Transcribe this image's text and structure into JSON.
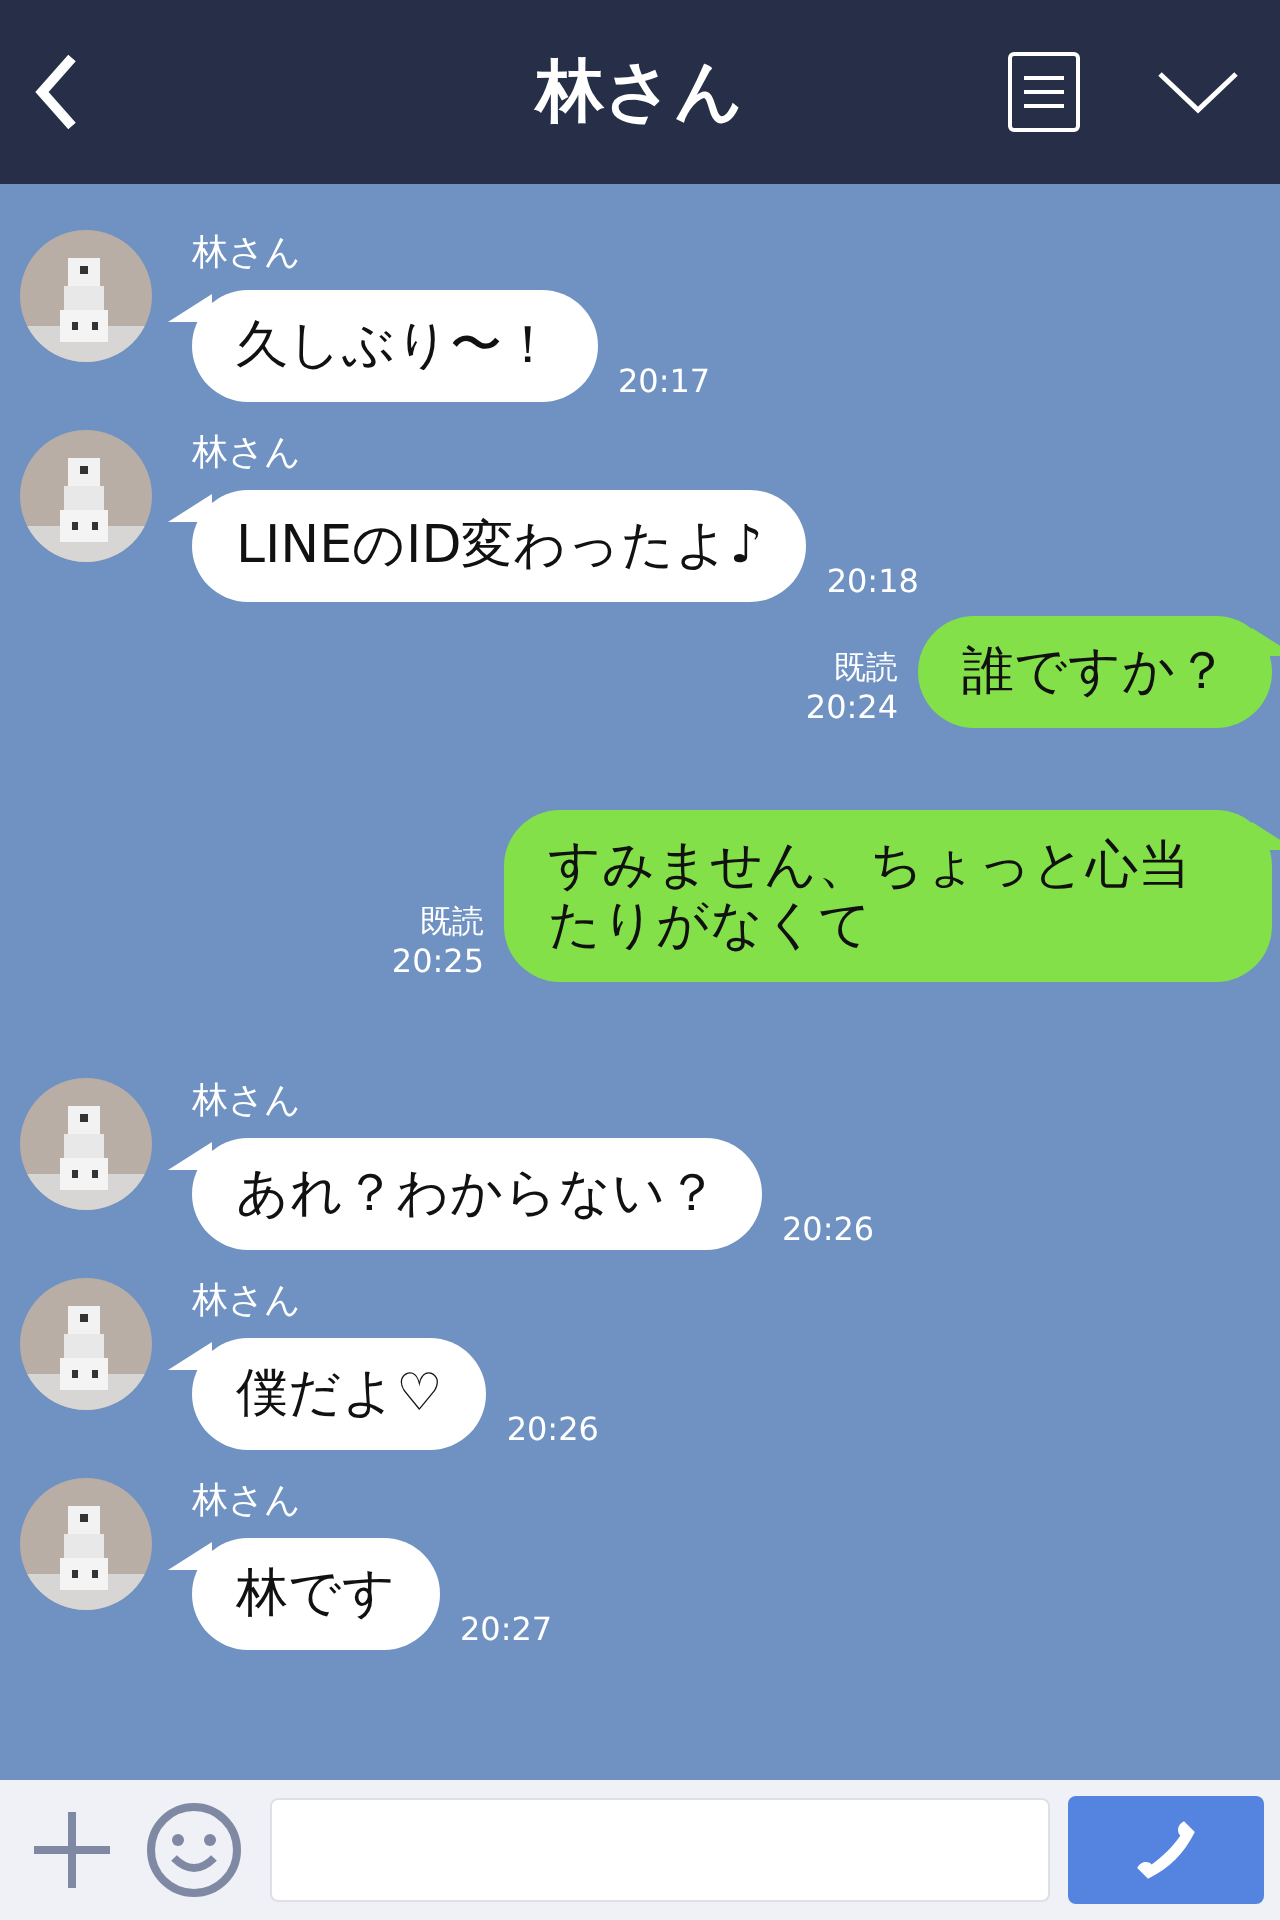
{
  "header": {
    "title": "林さん"
  },
  "messages": [
    {
      "kind": "received",
      "sender": "林さん",
      "text": "久しぶり〜！",
      "time": "20:17"
    },
    {
      "kind": "received",
      "sender": "林さん",
      "text": "LINEのID変わったよ♪",
      "time": "20:18"
    },
    {
      "kind": "sent",
      "read": "既読",
      "text": "誰ですか？",
      "time": "20:24"
    },
    {
      "kind": "sent",
      "read": "既読",
      "text": "すみません、ちょっと心当たりがなくて",
      "time": "20:25"
    },
    {
      "kind": "received",
      "sender": "林さん",
      "text": "あれ？わからない？",
      "time": "20:26"
    },
    {
      "kind": "received",
      "sender": "林さん",
      "text": "僕だよ♡",
      "time": "20:26"
    },
    {
      "kind": "received",
      "sender": "林さん",
      "text": "林です",
      "time": "20:27"
    }
  ]
}
